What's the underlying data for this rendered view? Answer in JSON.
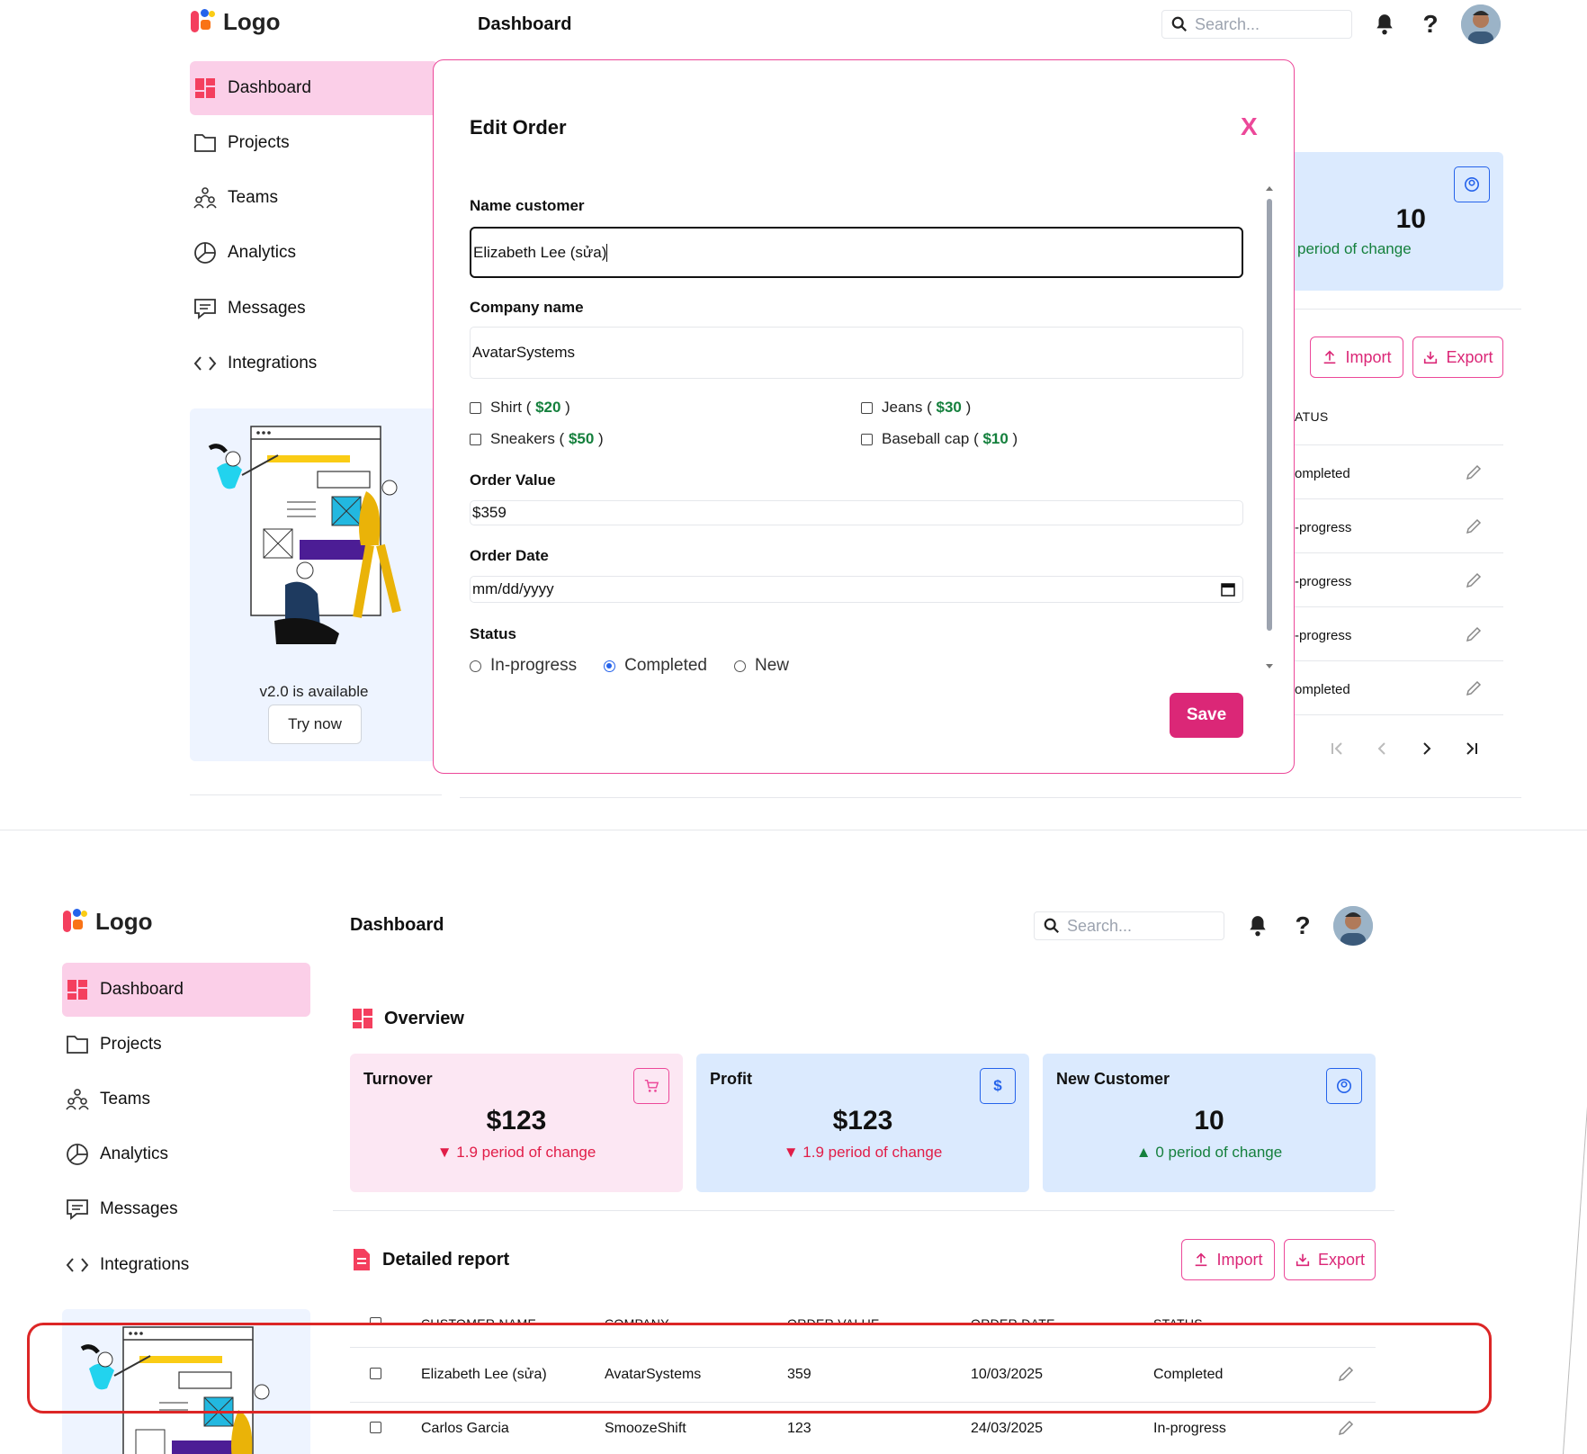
{
  "app": {
    "logo_text": "Logo",
    "page_title": "Dashboard",
    "search_placeholder": "Search..."
  },
  "sidebar": {
    "items": [
      {
        "label": "Dashboard",
        "icon": "dashboard-icon"
      },
      {
        "label": "Projects",
        "icon": "folder-icon"
      },
      {
        "label": "Teams",
        "icon": "teams-icon"
      },
      {
        "label": "Analytics",
        "icon": "pie-chart-icon"
      },
      {
        "label": "Messages",
        "icon": "message-icon"
      },
      {
        "label": "Integrations",
        "icon": "code-icon"
      }
    ],
    "promo": {
      "text": "v2.0 is available",
      "button": "Try now"
    }
  },
  "overview": {
    "title": "Overview",
    "cards": [
      {
        "title": "Turnover",
        "value": "$123",
        "change": "1.9 period of change",
        "trend": "down",
        "icon": "cart-icon"
      },
      {
        "title": "Profit",
        "value": "$123",
        "change": "1.9 period of change",
        "trend": "down",
        "icon": "dollar-icon"
      },
      {
        "title": "New Customer",
        "value": "10",
        "change": "0 period of change",
        "trend": "up",
        "icon": "user-circle-icon"
      }
    ]
  },
  "report": {
    "title": "Detailed report",
    "import_label": "Import",
    "export_label": "Export",
    "columns": [
      "CUSTOMER NAME",
      "COMPANY",
      "ORDER VALUE",
      "ORDER DATE",
      "STATUS"
    ],
    "rows": [
      {
        "name": "Elizabeth Lee (sửa)",
        "company": "AvatarSystems",
        "value": "359",
        "date": "10/03/2025",
        "status": "Completed"
      },
      {
        "name": "Carlos Garcia",
        "company": "SmoozeShift",
        "value": "123",
        "date": "24/03/2025",
        "status": "In-progress"
      }
    ]
  },
  "background_table": {
    "visible_header": "ATUS",
    "visible_statuses": [
      "ompleted",
      "-progress",
      "-progress",
      "-progress",
      "ompleted"
    ],
    "card_value": "10",
    "card_change": "period of change"
  },
  "modal": {
    "title": "Edit Order",
    "close_label": "X",
    "name_label": "Name customer",
    "name_value": "Elizabeth Lee (sửa)",
    "company_label": "Company name",
    "company_value": "AvatarSystems",
    "products": [
      {
        "name": "Shirt",
        "price": "$20",
        "checked": false
      },
      {
        "name": "Jeans",
        "price": "$30",
        "checked": false
      },
      {
        "name": "Sneakers",
        "price": "$50",
        "checked": false
      },
      {
        "name": "Baseball cap",
        "price": "$10",
        "checked": false
      }
    ],
    "order_value_label": "Order Value",
    "order_value": "$359",
    "order_date_label": "Order Date",
    "order_date_placeholder": "mm/dd/yyyy",
    "status_label": "Status",
    "status_options": [
      "In-progress",
      "Completed",
      "New"
    ],
    "status_selected": "Completed",
    "save_label": "Save"
  },
  "colors": {
    "accent": "#db2777",
    "active_nav": "#fbcfe8",
    "pink_card": "#fce7f3",
    "blue_card": "#dbeafe",
    "positive": "#15803d",
    "negative": "#e11d48",
    "annotation": "#dc2626"
  }
}
